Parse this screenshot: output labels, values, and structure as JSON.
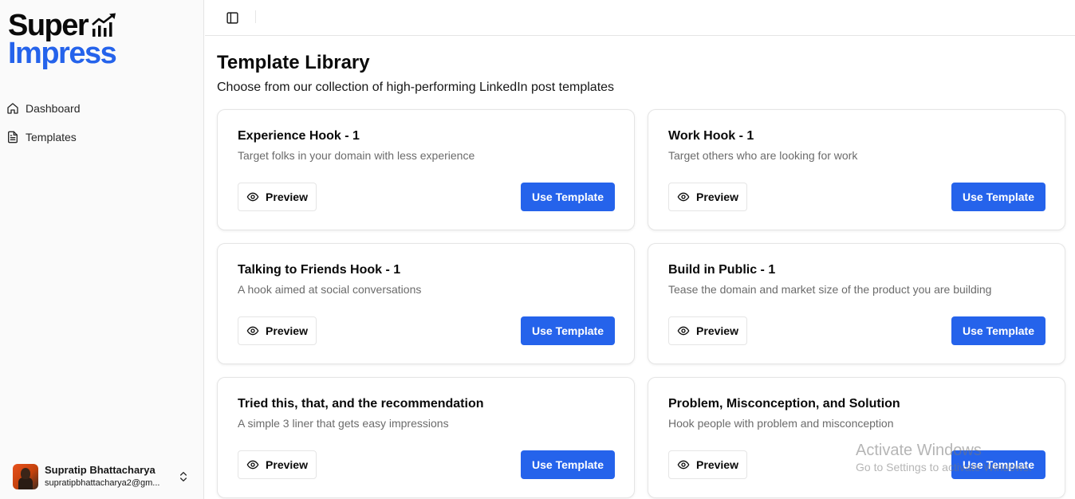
{
  "brand": {
    "line1": "Super",
    "line2": "Impress",
    "accent": "#2563eb"
  },
  "sidebar": {
    "items": [
      {
        "label": "Dashboard",
        "icon": "home-icon"
      },
      {
        "label": "Templates",
        "icon": "file-text-icon"
      }
    ]
  },
  "user": {
    "name": "Supratip Bhattacharya",
    "email": "supratipbhattacharya2@gm..."
  },
  "page": {
    "title": "Template Library",
    "subtitle": "Choose from our collection of high-performing LinkedIn post templates"
  },
  "templates": [
    {
      "title": "Experience Hook - 1",
      "description": "Target folks in your domain with less experience",
      "preview_label": "Preview",
      "use_label": "Use Template"
    },
    {
      "title": "Work Hook - 1",
      "description": "Target others who are looking for work",
      "preview_label": "Preview",
      "use_label": "Use Template"
    },
    {
      "title": "Talking to Friends Hook - 1",
      "description": "A hook aimed at social conversations",
      "preview_label": "Preview",
      "use_label": "Use Template"
    },
    {
      "title": "Build in Public - 1",
      "description": "Tease the domain and market size of the product you are building",
      "preview_label": "Preview",
      "use_label": "Use Template"
    },
    {
      "title": "Tried this, that, and the recommendation",
      "description": "A simple 3 liner that gets easy impressions",
      "preview_label": "Preview",
      "use_label": "Use Template"
    },
    {
      "title": "Problem, Misconception, and Solution",
      "description": "Hook people with problem and misconception",
      "preview_label": "Preview",
      "use_label": "Use Template"
    }
  ],
  "watermark": {
    "title": "Activate Windows",
    "subtitle": "Go to Settings to activate Windows."
  },
  "colors": {
    "primary": "#2563eb",
    "sidebar_bg": "#fafafa",
    "border": "#e5e5e5",
    "muted_text": "#6b6b6b"
  }
}
